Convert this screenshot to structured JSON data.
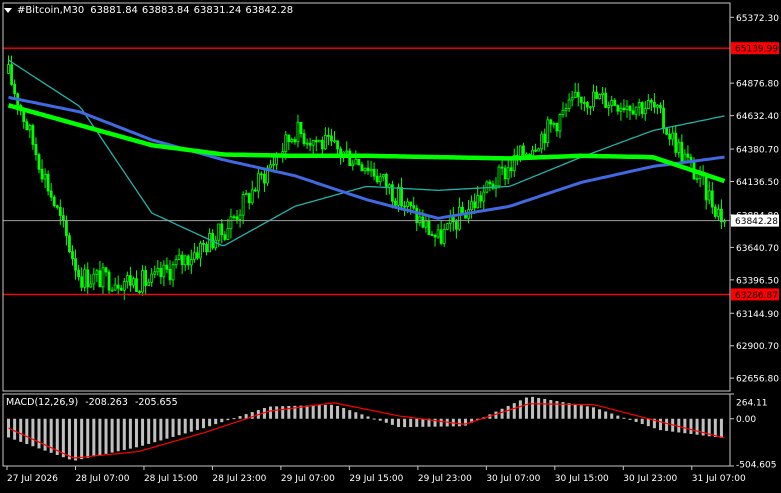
{
  "window": {
    "symbol": "#Bitcoin,M30",
    "ohlc": [
      "63881.84",
      "63883.84",
      "63831.24",
      "63842.28"
    ]
  },
  "price_axis": {
    "ticks": [
      "65372.30",
      "64876.80",
      "64632.40",
      "64380.70",
      "64136.50",
      "63884.80",
      "63640.70",
      "63396.50",
      "63144.90",
      "62900.70",
      "62656.80"
    ],
    "current_price": "63842.28",
    "resistance_label": "65139.99",
    "support_label": "63286.87"
  },
  "indicator": {
    "name": "MACD(12,26,9)",
    "macd": "-208.263",
    "signal": "-205.655",
    "axis_ticks": [
      "264.11",
      "0.00",
      "-504.605"
    ]
  },
  "time_axis": [
    "27 Jul 2026",
    "28 Jul 07:00",
    "28 Jul 15:00",
    "28 Jul 23:00",
    "29 Jul 07:00",
    "29 Jul 15:00",
    "29 Jul 23:00",
    "30 Jul 07:00",
    "30 Jul 15:00",
    "30 Jul 23:00",
    "31 Jul 07:00"
  ],
  "colors": {
    "background": "#000000",
    "candle": "#00ff00",
    "grid": "#c8c8c8",
    "resistance_line": "#ff0000",
    "support_line": "#ff0000",
    "ma_fast": "#20b2aa",
    "ma_mid": "#4169e1",
    "ma_slow": "#00ff00",
    "macd_hist": "#c0c0c0",
    "macd_signal": "#ff0000"
  },
  "chart_data": {
    "type": "candlestick",
    "timeframe": "M30",
    "ylim": [
      62560,
      65480
    ],
    "levels": [
      65139.99,
      63286.87
    ],
    "x": [
      "27 Jul 2026",
      "28 Jul 07:00",
      "28 Jul 15:00",
      "28 Jul 23:00",
      "29 Jul 07:00",
      "29 Jul 15:00",
      "29 Jul 23:00",
      "30 Jul 07:00",
      "30 Jul 15:00",
      "30 Jul 23:00",
      "31 Jul 07:00"
    ],
    "close": [
      64950,
      63420,
      63380,
      63760,
      64520,
      64270,
      63700,
      64250,
      64780,
      64700,
      63842.28
    ],
    "ma_fast": [
      65050,
      64700,
      63900,
      63650,
      63950,
      64100,
      64070,
      64100,
      64320,
      64520,
      64630
    ],
    "ma_mid": [
      64770,
      64660,
      64450,
      64300,
      64180,
      64000,
      63860,
      63950,
      64130,
      64250,
      64320
    ],
    "ma_slow": [
      64710,
      64560,
      64410,
      64340,
      64330,
      64330,
      64320,
      64310,
      64330,
      64320,
      64140
    ],
    "macd_hist": [
      -200,
      -450,
      -300,
      -100,
      130,
      150,
      -90,
      -80,
      240,
      120,
      -120,
      -208.263
    ],
    "macd_signal": [
      -100,
      -420,
      -350,
      -150,
      80,
      170,
      30,
      -60,
      160,
      150,
      -30,
      -205.655
    ]
  }
}
